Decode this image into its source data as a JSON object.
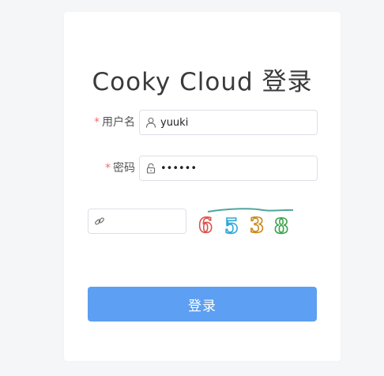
{
  "login": {
    "title": "Cooky Cloud 登录",
    "username": {
      "label": "用户名",
      "required_mark": "*",
      "value": "yuuki",
      "icon": "user-icon"
    },
    "password": {
      "label": "密码",
      "required_mark": "*",
      "value": "••••••",
      "icon": "lock-icon"
    },
    "captcha_input": {
      "value": "",
      "icon": "link-icon"
    },
    "captcha_image": {
      "digits": [
        "6",
        "5",
        "3",
        "8"
      ],
      "colors": [
        "#d9534f",
        "#31a8d6",
        "#c98a1a",
        "#3aa34a"
      ]
    },
    "submit_label": "登录",
    "colors": {
      "primary": "#5d9ff2",
      "required": "#f56c6c",
      "background": "#f5f6f8"
    }
  }
}
